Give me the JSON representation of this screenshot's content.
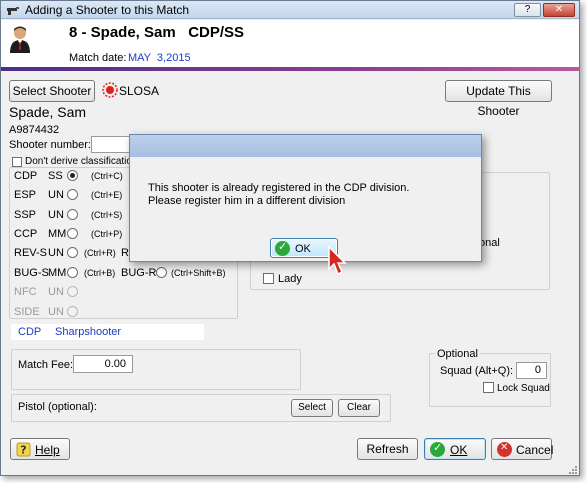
{
  "window": {
    "title": "Adding a Shooter to this Match",
    "help_btn": "?",
    "close_btn": "✕"
  },
  "header": {
    "shooter_heading": "8 - Spade, Sam   CDP/SS",
    "match_date_label": "Match date:",
    "match_date_value": "MAY  3,2015"
  },
  "toolbar": {
    "select_shooter": "Select Shooter",
    "slosa": "SLOSA",
    "update_shooter": "Update This Shooter"
  },
  "shooter": {
    "name": "Spade, Sam",
    "id": "A9874432",
    "number_label": "Shooter number:",
    "number_value": "",
    "dont_derive": "Don't derive classification"
  },
  "divisions": [
    {
      "code": "CDP",
      "cls": "SS",
      "shortcut": "(Ctrl+C)",
      "selected": true,
      "enabled": true
    },
    {
      "code": "ESP",
      "cls": "UN",
      "shortcut": "(Ctrl+E)",
      "selected": false,
      "enabled": true
    },
    {
      "code": "SSP",
      "cls": "UN",
      "shortcut": "(Ctrl+S)",
      "selected": false,
      "enabled": true
    },
    {
      "code": "CCP",
      "cls": "MM",
      "shortcut": "(Ctrl+P)",
      "selected": false,
      "enabled": true
    },
    {
      "code": "REV-S",
      "cls": "UN",
      "shortcut": "(Ctrl+R)",
      "selected": false,
      "enabled": true
    },
    {
      "code": "BUG-S",
      "cls": "MM",
      "shortcut": "(Ctrl+B)",
      "selected": false,
      "enabled": true
    },
    {
      "code": "NFC",
      "cls": "UN",
      "shortcut": "",
      "selected": false,
      "enabled": false
    },
    {
      "code": "SIDE",
      "cls": "UN",
      "shortcut": "",
      "selected": false,
      "enabled": false
    }
  ],
  "extra_divisions": {
    "rev_o_fragment": "R",
    "bug_r": "BUG-R",
    "bug_r_shortcut": "(Ctrl+Shift+B)"
  },
  "summary": {
    "division": "CDP",
    "classification": "Sharpshooter"
  },
  "right_panel": {
    "onal_fragment": "onal",
    "lady": "Lady"
  },
  "fee": {
    "label": "Match Fee:",
    "value": "0.00"
  },
  "optional": {
    "group_label": "Optional",
    "squad_label": "Squad (Alt+Q):",
    "squad_value": "0",
    "lock_squad": "Lock Squad"
  },
  "pistol": {
    "label": "Pistol (optional):",
    "select": "Select",
    "clear": "Clear"
  },
  "footer": {
    "help": "Help",
    "refresh": "Refresh",
    "ok": "OK",
    "cancel": "Cancel"
  },
  "dialog": {
    "line1": "This shooter is already registered in the CDP division.",
    "line2": "Please register him in a different division",
    "ok": "OK"
  },
  "colors": {
    "accent_blue": "#1a3cc8",
    "header_band": "#6a3a8e",
    "slosa_red": "#e0201a"
  }
}
